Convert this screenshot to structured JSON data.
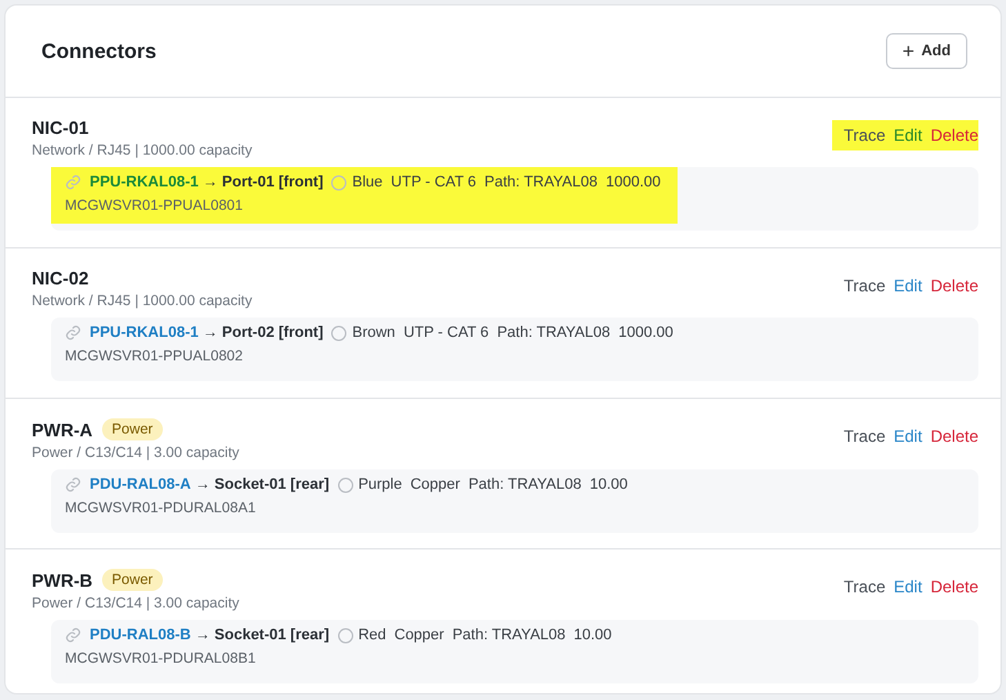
{
  "title": "Connectors",
  "add_button": {
    "icon": "+",
    "label": "Add"
  },
  "connectors": [
    {
      "name": "NIC-01",
      "meta": "Network / RJ45 | 1000.00 capacity",
      "highlighted": true,
      "connection": {
        "device": "PPU-RKAL08-1",
        "port": "→ Port-01 [front]",
        "cable_color": "Blue",
        "medium": "UTP - CAT 6",
        "path": "Path: TRAYAL08",
        "capacity": "1000.00",
        "cable": "MCGWSVR01-PPUAL0801"
      },
      "actions": [
        "Trace",
        "Edit",
        "Delete"
      ]
    },
    {
      "name": "NIC-02",
      "meta": "Network / RJ45 | 1000.00 capacity",
      "highlighted": false,
      "connection": {
        "device": "PPU-RKAL08-1",
        "port": "→ Port-02 [front]",
        "cable_color": "Brown",
        "medium": "UTP - CAT 6",
        "path": "Path: TRAYAL08",
        "capacity": "1000.00",
        "cable": "MCGWSVR01-PPUAL0802"
      },
      "actions": [
        "Trace",
        "Edit",
        "Delete"
      ]
    },
    {
      "name": "PWR-A",
      "badge": "Power",
      "meta": "Power / C13/C14 | 3.00 capacity",
      "highlighted": false,
      "connection": {
        "device": "PDU-RAL08-A",
        "port": "→ Socket-01 [rear]",
        "cable_color": "Purple",
        "medium": "Copper",
        "path": "Path: TRAYAL08",
        "capacity": "10.00",
        "cable": "MCGWSVR01-PDURAL08A1"
      },
      "actions": [
        "Trace",
        "Edit",
        "Delete"
      ]
    },
    {
      "name": "PWR-B",
      "badge": "Power",
      "meta": "Power / C13/C14 | 3.00 capacity",
      "highlighted": false,
      "connection": {
        "device": "PDU-RAL08-B",
        "port": "→ Socket-01 [rear]",
        "cable_color": "Red",
        "medium": "Copper",
        "path": "Path: TRAYAL08",
        "capacity": "10.00",
        "cable": "MCGWSVR01-PDURAL08B1"
      },
      "actions": [
        "Trace",
        "Edit",
        "Delete"
      ]
    }
  ]
}
